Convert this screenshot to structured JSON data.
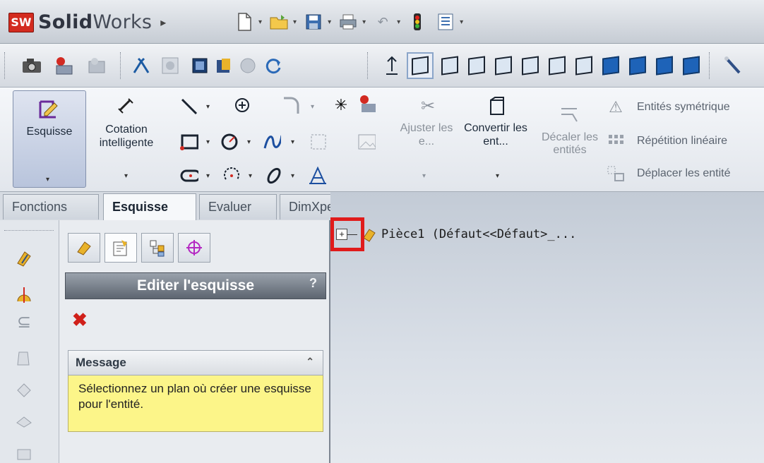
{
  "app": {
    "logo_badge": "SW",
    "name_bold": "Solid",
    "name_rest": "Works"
  },
  "ribbon": {
    "esquisse_label": "Esquisse",
    "cotation_label": "Cotation intelligente",
    "ajuster_label": "Ajuster les e...",
    "convertir_label": "Convertir les ent...",
    "decaler_label": "Décaler les entités",
    "symetriques_label": "Entités symétrique",
    "repetition_label": "Répétition linéaire",
    "deplacer_label": "Déplacer les entité"
  },
  "tabs": [
    {
      "label": "Fonctions"
    },
    {
      "label": "Esquisse"
    },
    {
      "label": "Evaluer"
    },
    {
      "label": "DimXpert"
    }
  ],
  "panel": {
    "title": "Editer l'esquisse",
    "help": "?",
    "message_title": "Message",
    "message_text": "Sélectionnez un plan où créer une esquisse pour l'entité."
  },
  "tree": {
    "expander": "+",
    "root_label": "Pièce1 (Défaut<<Défaut>_..."
  },
  "colors": {
    "accent": "#1e63b8",
    "highlight": "#e01b1b",
    "message_bg": "#fcf589"
  }
}
